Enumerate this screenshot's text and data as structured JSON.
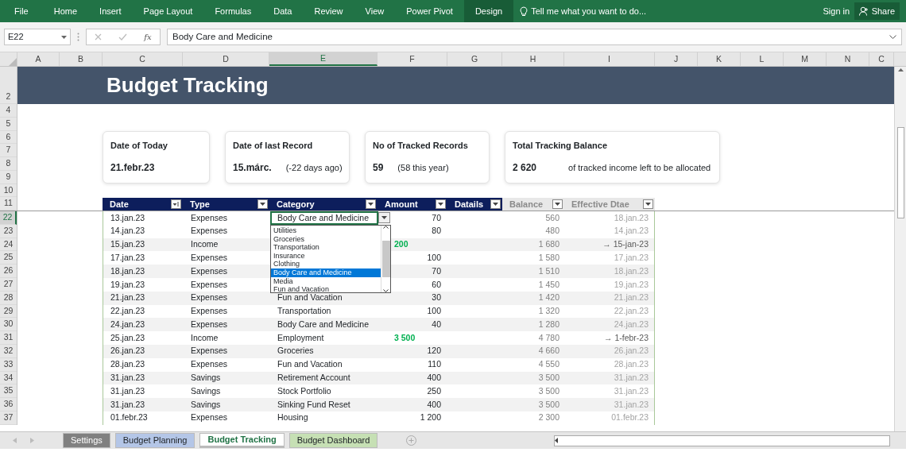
{
  "ribbon": {
    "tabs": [
      {
        "label": "File",
        "selected": false
      },
      {
        "label": "Home",
        "selected": false
      },
      {
        "label": "Insert",
        "selected": false
      },
      {
        "label": "Page Layout",
        "selected": false
      },
      {
        "label": "Formulas",
        "selected": false
      },
      {
        "label": "Data",
        "selected": false
      },
      {
        "label": "Review",
        "selected": false
      },
      {
        "label": "View",
        "selected": false
      },
      {
        "label": "Power Pivot",
        "selected": false
      },
      {
        "label": "Design",
        "selected": true
      }
    ],
    "tell_me": "Tell me what you want to do...",
    "sign_in": "Sign in",
    "share": "Share"
  },
  "formula_bar": {
    "name_box": "E22",
    "function_label": "fx",
    "formula": "Body Care and Medicine"
  },
  "column_headers": [
    {
      "label": "A",
      "selected": false
    },
    {
      "label": "B",
      "selected": false
    },
    {
      "label": "C",
      "selected": false
    },
    {
      "label": "D",
      "selected": false
    },
    {
      "label": "E",
      "selected": true
    },
    {
      "label": "F",
      "selected": false
    },
    {
      "label": "G",
      "selected": false
    },
    {
      "label": "H",
      "selected": false
    },
    {
      "label": "I",
      "selected": false
    },
    {
      "label": "J",
      "selected": false
    },
    {
      "label": "K",
      "selected": false
    },
    {
      "label": "L",
      "selected": false
    },
    {
      "label": "M",
      "selected": false
    },
    {
      "label": "N",
      "selected": false
    },
    {
      "label": "C",
      "selected": false
    }
  ],
  "frozen_row_headers": [
    {
      "label": "2",
      "selected": false
    },
    {
      "label": "4",
      "selected": false
    },
    {
      "label": "5",
      "selected": false
    },
    {
      "label": "6",
      "selected": false
    },
    {
      "label": "7",
      "selected": false
    },
    {
      "label": "8",
      "selected": false
    },
    {
      "label": "9",
      "selected": false
    },
    {
      "label": "10",
      "selected": false
    },
    {
      "label": "11",
      "selected": false
    }
  ],
  "row_headers": [
    {
      "label": "22",
      "selected": true
    },
    {
      "label": "23",
      "selected": false
    },
    {
      "label": "24",
      "selected": false
    },
    {
      "label": "25",
      "selected": false
    },
    {
      "label": "26",
      "selected": false
    },
    {
      "label": "27",
      "selected": false
    },
    {
      "label": "28",
      "selected": false
    },
    {
      "label": "29",
      "selected": false
    },
    {
      "label": "30",
      "selected": false
    },
    {
      "label": "31",
      "selected": false
    },
    {
      "label": "32",
      "selected": false
    },
    {
      "label": "33",
      "selected": false
    },
    {
      "label": "34",
      "selected": false
    },
    {
      "label": "35",
      "selected": false
    },
    {
      "label": "36",
      "selected": false
    },
    {
      "label": "37",
      "selected": false
    }
  ],
  "title": "Budget Tracking",
  "cards": [
    {
      "title": "Date of Today",
      "value": "21.febr.23"
    },
    {
      "title": "Date of last Record",
      "value": "15.márc.",
      "note": "(-22 days ago)"
    },
    {
      "title": "No of Tracked Records",
      "value": "59",
      "note": "(58 this year)"
    },
    {
      "title": "Total Tracking Balance",
      "value": "2 620",
      "note": "of tracked income left to be allocated"
    }
  ],
  "table": {
    "columns": [
      {
        "label": "Date",
        "kind": "input",
        "sorted": true
      },
      {
        "label": "Type",
        "kind": "input",
        "sorted": false
      },
      {
        "label": "Category",
        "kind": "input",
        "sorted": false
      },
      {
        "label": "Amount",
        "kind": "input",
        "sorted": false
      },
      {
        "label": "Datails",
        "kind": "input",
        "sorted": false
      },
      {
        "label": "Balance",
        "kind": "computed",
        "sorted": false
      },
      {
        "label": "Effective Dtae",
        "kind": "computed",
        "sorted": false
      }
    ],
    "rows": [
      {
        "date": "13.jan.23",
        "type": "Expenses",
        "category": "Body Care and Medicine",
        "amount": "70",
        "income": false,
        "balance": "560",
        "effective": "18.jan.23",
        "shifted": false,
        "active": true
      },
      {
        "date": "14.jan.23",
        "type": "Expenses",
        "amount": "80",
        "income": false,
        "balance": "480",
        "effective": "14.jan.23",
        "shifted": false,
        "active": false
      },
      {
        "date": "15.jan.23",
        "type": "Income",
        "amount": "200",
        "income": true,
        "balance": "1 680",
        "effective": "→ 15-jan-23",
        "shifted": true,
        "active": false
      },
      {
        "date": "17.jan.23",
        "type": "Expenses",
        "amount": "100",
        "income": false,
        "balance": "1 580",
        "effective": "17.jan.23",
        "shifted": false,
        "active": false
      },
      {
        "date": "18.jan.23",
        "type": "Expenses",
        "amount": "70",
        "income": false,
        "balance": "1 510",
        "effective": "18.jan.23",
        "shifted": false,
        "active": false
      },
      {
        "date": "19.jan.23",
        "type": "Expenses",
        "amount": "60",
        "income": false,
        "balance": "1 450",
        "effective": "19.jan.23",
        "shifted": false,
        "active": false
      },
      {
        "date": "21.jan.23",
        "type": "Expenses",
        "category": "Fun and Vacation",
        "amount": "30",
        "income": false,
        "balance": "1 420",
        "effective": "21.jan.23",
        "shifted": false,
        "active": false
      },
      {
        "date": "22.jan.23",
        "type": "Expenses",
        "category": "Transportation",
        "amount": "100",
        "income": false,
        "balance": "1 320",
        "effective": "22.jan.23",
        "shifted": false,
        "active": false
      },
      {
        "date": "24.jan.23",
        "type": "Expenses",
        "category": "Body Care and Medicine",
        "amount": "40",
        "income": false,
        "balance": "1 280",
        "effective": "24.jan.23",
        "shifted": false,
        "active": false
      },
      {
        "date": "25.jan.23",
        "type": "Income",
        "category": "Employment",
        "amount": "3 500",
        "income": true,
        "balance": "4 780",
        "effective": "→ 1-febr-23",
        "shifted": true,
        "active": false
      },
      {
        "date": "26.jan.23",
        "type": "Expenses",
        "category": "Groceries",
        "amount": "120",
        "income": false,
        "balance": "4 660",
        "effective": "26.jan.23",
        "shifted": false,
        "active": false
      },
      {
        "date": "28.jan.23",
        "type": "Expenses",
        "category": "Fun and Vacation",
        "amount": "110",
        "income": false,
        "balance": "4 550",
        "effective": "28.jan.23",
        "shifted": false,
        "active": false
      },
      {
        "date": "31.jan.23",
        "type": "Savings",
        "category": "Retirement Account",
        "amount": "400",
        "income": false,
        "balance": "3 500",
        "effective": "31.jan.23",
        "shifted": false,
        "active": false
      },
      {
        "date": "31.jan.23",
        "type": "Savings",
        "category": "Stock Portfolio",
        "amount": "250",
        "income": false,
        "balance": "3 500",
        "effective": "31.jan.23",
        "shifted": false,
        "active": false
      },
      {
        "date": "31.jan.23",
        "type": "Savings",
        "category": "Sinking Fund Reset",
        "amount": "400",
        "income": false,
        "balance": "3 500",
        "effective": "31.jan.23",
        "shifted": false,
        "active": false
      },
      {
        "date": "01.febr.23",
        "type": "Expenses",
        "category": "Housing",
        "amount": "1 200",
        "income": false,
        "balance": "2 300",
        "effective": "01.febr.23",
        "shifted": false,
        "active": false
      }
    ]
  },
  "dropdown": {
    "items": [
      {
        "label": "Utilities",
        "selected": false
      },
      {
        "label": "Groceries",
        "selected": false
      },
      {
        "label": "Transportation",
        "selected": false
      },
      {
        "label": "Insurance",
        "selected": false
      },
      {
        "label": "Clothing",
        "selected": false
      },
      {
        "label": "Body Care and Medicine",
        "selected": true
      },
      {
        "label": "Media",
        "selected": false
      },
      {
        "label": "Fun and Vacation",
        "selected": false
      }
    ]
  },
  "sheet_tabs": [
    {
      "label": "Settings",
      "color": "#808080",
      "selected": false
    },
    {
      "label": "Budget Planning",
      "color": "#b4c6e7",
      "selected": false
    },
    {
      "label": "Budget Tracking",
      "selected": true
    },
    {
      "label": "Budget Dashboard",
      "color": "#c6e0b4",
      "selected": false
    }
  ]
}
